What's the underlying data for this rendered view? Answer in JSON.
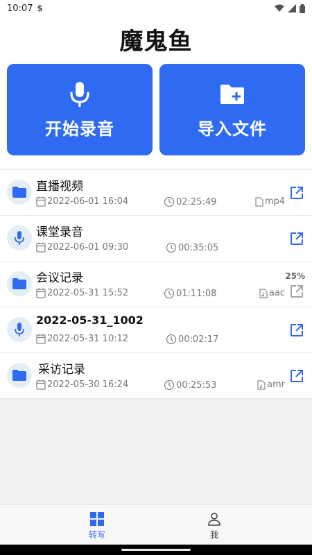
{
  "status": {
    "time": "10:07",
    "carrier_icon": "s-icon",
    "wifi_icon": "wifi-icon",
    "signal_icon": "signal-icon",
    "battery_icon": "battery-icon"
  },
  "app": {
    "title": "魔鬼鱼"
  },
  "actions": {
    "record_label": "开始录音",
    "import_label": "导入文件",
    "accent_color": "#2f6bf0"
  },
  "files": [
    {
      "title": "直播视频",
      "type_icon": "folder-icon",
      "date": "2022-06-01 16:04",
      "duration": "02:25:49",
      "format": "mp4"
    },
    {
      "title": "课堂录音",
      "type_icon": "microphone-icon",
      "date": "2022-06-01 09:30",
      "duration": "00:35:05"
    },
    {
      "title": "会议记录",
      "type_icon": "folder-icon",
      "date": "2022-05-31 15:52",
      "duration": "01:11:08",
      "format": "aac",
      "progress": "25%"
    },
    {
      "title": "2022-05-31_1002",
      "type_icon": "microphone-icon",
      "date": "2022-05-31 10:12",
      "duration": "00:02:17"
    },
    {
      "title": "采访记录",
      "type_icon": "folder-icon",
      "date": "2022-05-30 16:24",
      "duration": "00:25:53",
      "format": "amr"
    }
  ],
  "nav": {
    "transcribe_label": "转写",
    "me_label": "我",
    "active": "transcribe"
  }
}
